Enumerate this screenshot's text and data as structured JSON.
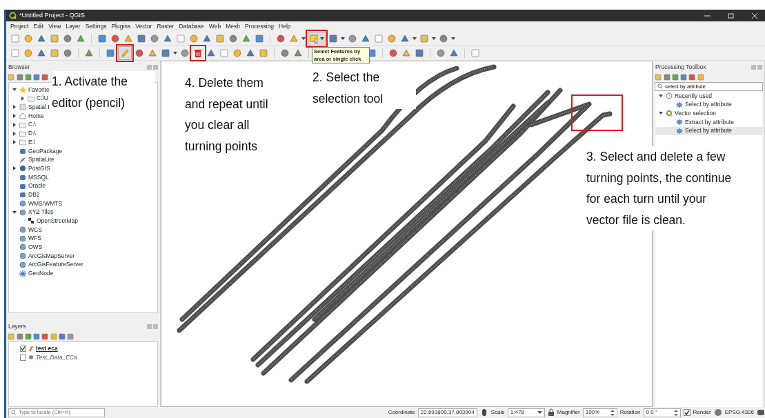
{
  "window": {
    "title": "*Untitled Project - QGIS"
  },
  "menu": [
    "Project",
    "Edit",
    "View",
    "Layer",
    "Settings",
    "Plugins",
    "Vector",
    "Raster",
    "Database",
    "Web",
    "Mesh",
    "Processing",
    "Help"
  ],
  "toolbar": {
    "editing_on": true,
    "select_tool_on": true
  },
  "tooltip": {
    "text": "Select Features by area or single click"
  },
  "browser": {
    "title": "Browser",
    "items": [
      {
        "label": "Favorite",
        "expanded": true,
        "children": [
          {
            "label": "C:\\U",
            "expanded": false
          }
        ]
      },
      {
        "label": "Spatial I",
        "expanded": false
      },
      {
        "label": "Home",
        "expanded": false
      },
      {
        "label": "C:\\",
        "expanded": false
      },
      {
        "label": "D:\\",
        "expanded": false
      },
      {
        "label": "E:\\",
        "expanded": false
      },
      {
        "label": "GeoPackage"
      },
      {
        "label": "SpatiaLite"
      },
      {
        "label": "PostGIS",
        "expanded": false
      },
      {
        "label": "MSSQL"
      },
      {
        "label": "Oracle"
      },
      {
        "label": "DB2"
      },
      {
        "label": "WMS/WMTS"
      },
      {
        "label": "XYZ Tiles",
        "expanded": true,
        "children": [
          {
            "label": "OpenStreetMap"
          }
        ]
      },
      {
        "label": "WCS"
      },
      {
        "label": "WFS"
      },
      {
        "label": "OWS"
      },
      {
        "label": "ArcGisMapServer"
      },
      {
        "label": "ArcGisFeatureServer"
      },
      {
        "label": "GeoNode"
      }
    ]
  },
  "layers": {
    "title": "Layers",
    "items": [
      {
        "name": "test eca",
        "checked": true,
        "kind": "line",
        "active": true
      },
      {
        "name": "Test_Data_ECa",
        "checked": false,
        "kind": "point",
        "active": false
      }
    ]
  },
  "locate": {
    "placeholder": "Type to locate (Ctrl+K)"
  },
  "processing": {
    "title": "Processing Toolbox",
    "search": "select by attribute",
    "groups": [
      {
        "label": "Recently used",
        "kind": "history",
        "expanded": true,
        "children": [
          {
            "label": "Select by attribute",
            "selected": false
          }
        ]
      },
      {
        "label": "Vector selection",
        "kind": "provider",
        "expanded": true,
        "children": [
          {
            "label": "Extract by attribute",
            "selected": false
          },
          {
            "label": "Select by attribute",
            "selected": true
          }
        ]
      }
    ]
  },
  "annotations": [
    {
      "text": "1. Activate the editor (pencil)"
    },
    {
      "text": "4. Delete them and repeat until you clear all turning points"
    },
    {
      "text": "2. Select the selection tool"
    },
    {
      "text": "3. Select and delete a few turning points, the continue for each turn until your vector file is clean."
    }
  ],
  "status_bar": {
    "coordinate_label": "Coordinate",
    "coordinate": "22.693809,37.803904",
    "scale_label": "Scale",
    "scale": "1:478",
    "magnifier_label": "Magnifier",
    "magnifier": "100%",
    "rotation_label": "Rotation",
    "rotation": "0.0 °",
    "render": {
      "label": "Render",
      "checked": true
    },
    "crs": "EPSG:4326"
  }
}
